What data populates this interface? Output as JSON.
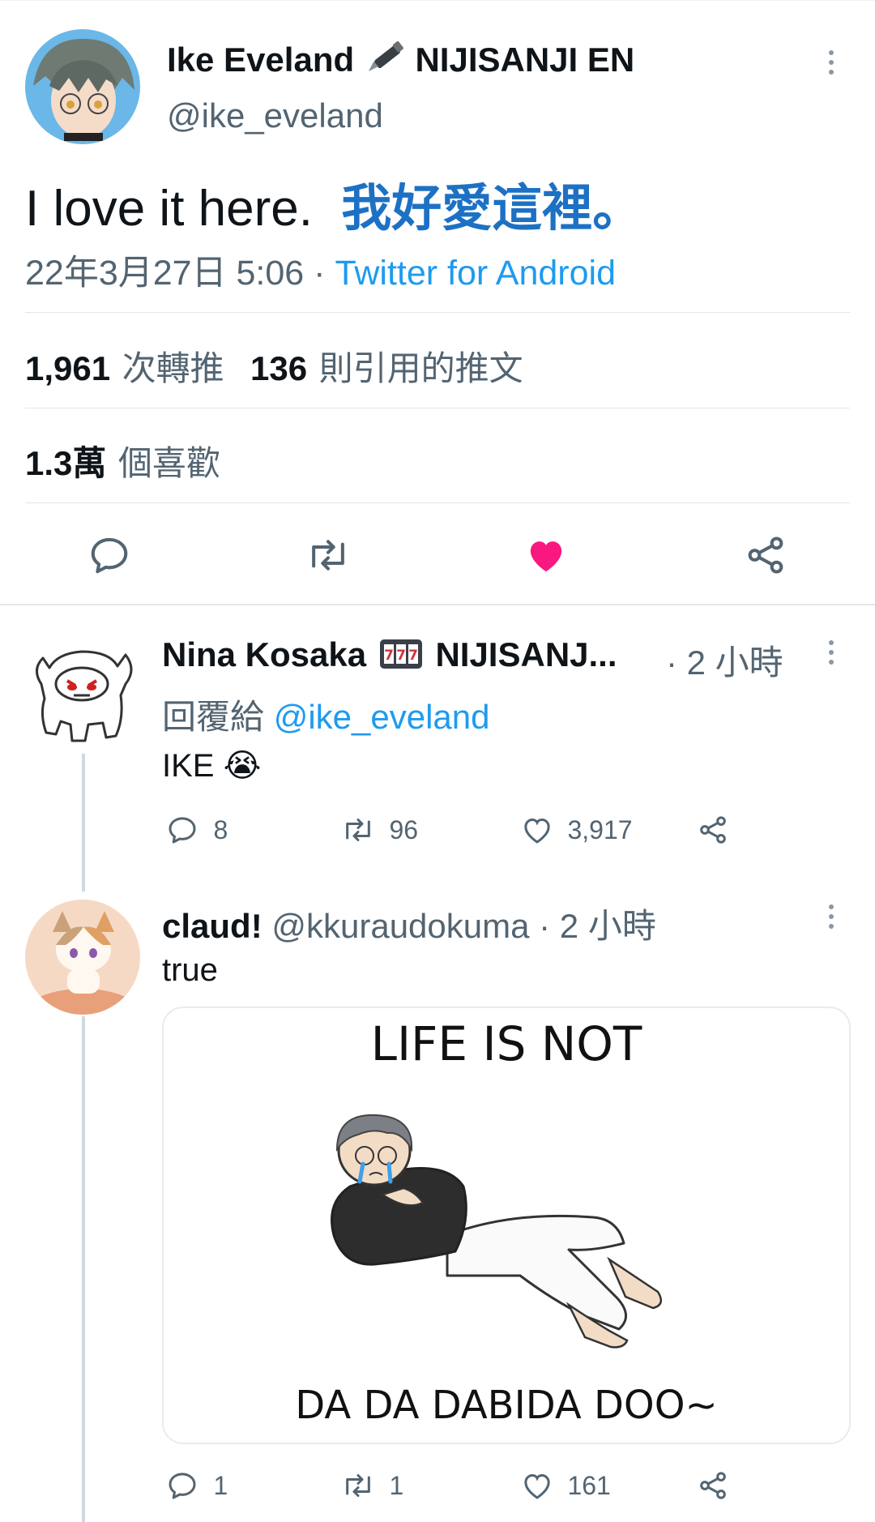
{
  "main_tweet": {
    "display_name": "Ike Eveland",
    "name_suffix": "NIJISANJI EN",
    "handle": "@ike_eveland",
    "text_en": "I love it here.",
    "text_zh": "我好愛這裡。",
    "timestamp": "22年3月27日 5:06",
    "separator": "·",
    "source": "Twitter for Android",
    "retweets_count": "1,961",
    "retweets_label": "次轉推",
    "quotes_count": "136",
    "quotes_label": "則引用的推文",
    "likes_count": "1.3萬",
    "likes_label": "個喜歡",
    "like_color": "#f91880"
  },
  "replies": [
    {
      "display_name": "Nina Kosaka",
      "name_rest": "NIJISANJ...",
      "time": "· 2 小時",
      "replying_label": "回覆給",
      "replying_to": "@ike_eveland",
      "text": "IKE",
      "emoji": "😭",
      "reply_count": "8",
      "retweet_count": "96",
      "like_count": "3,917"
    },
    {
      "display_name": "claud!",
      "handle": "@kkuraudokuma",
      "time": "· 2 小時",
      "text": "true",
      "media_top_text": "LIFE IS NOT",
      "media_bottom_text": "DA DA DABIDA DOO~",
      "reply_count": "1",
      "retweet_count": "1",
      "like_count": "161"
    }
  ],
  "icons": [
    "more-icon",
    "reply-icon",
    "retweet-icon",
    "like-icon",
    "share-icon",
    "pen-emoji",
    "slot-machine-emoji",
    "crying-emoji"
  ]
}
